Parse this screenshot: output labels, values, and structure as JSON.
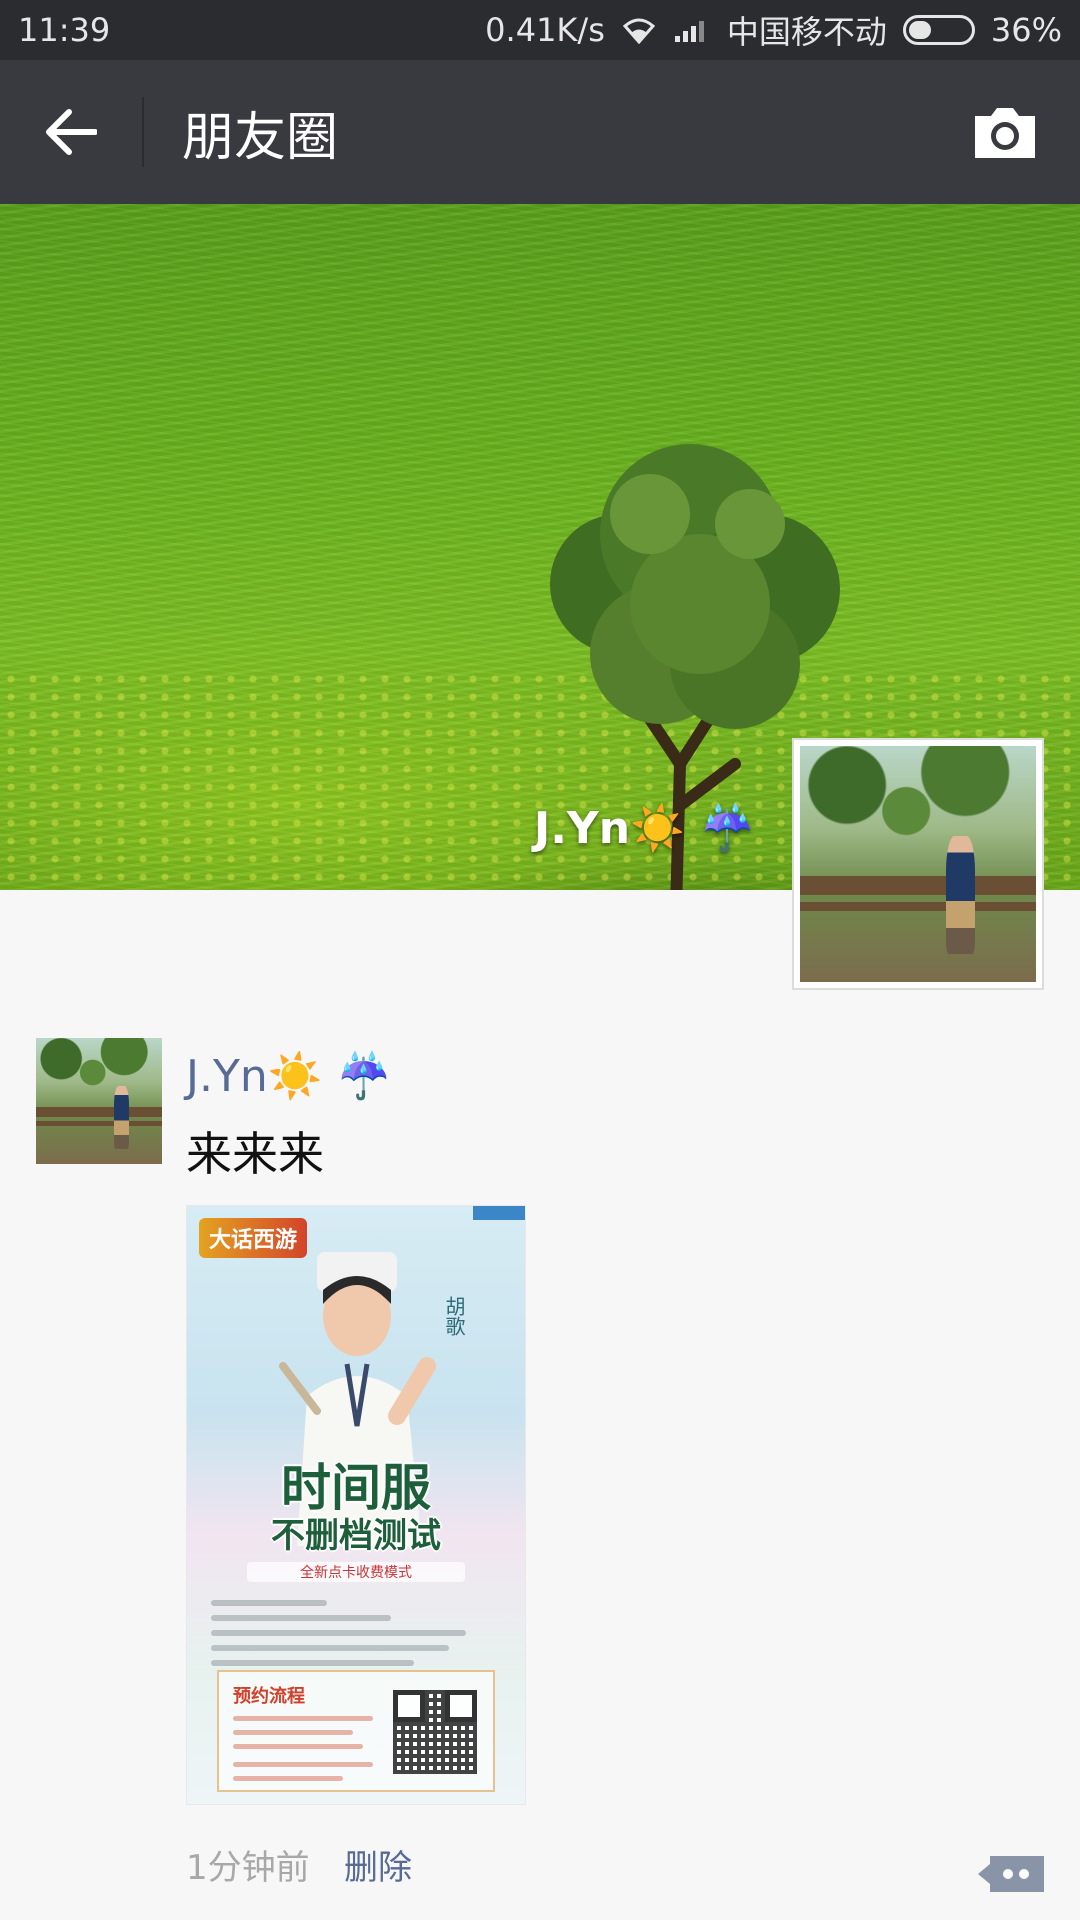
{
  "status_bar": {
    "time": "11:39",
    "network_speed": "0.41K/s",
    "carrier": "中国移不动",
    "battery_percent": "36%",
    "battery_level": 0.36,
    "wifi_icon": "wifi-icon",
    "signal_icon": "signal-icon"
  },
  "header": {
    "title": "朋友圈",
    "back_icon": "back-arrow-icon",
    "camera_icon": "camera-icon"
  },
  "cover": {
    "user_name": "J.Yn☀️ ☔️"
  },
  "post": {
    "user_name": "J.Yn☀️ ☔️",
    "text": "来来来",
    "image": {
      "logo": "大话西游",
      "side_name": "胡歌",
      "headline": "时间服",
      "headline2": "不删档测试",
      "tagline": "全新点卡收费模式",
      "box_title": "预约流程"
    },
    "time": "1分钟前",
    "delete_label": "删除",
    "comment_icon": "comment-more-icon"
  },
  "colors": {
    "status_bar_bg": "#2a2c30",
    "title_bar_bg": "#393a3f",
    "link_blue": "#576b95",
    "page_bg": "#f7f7f7"
  }
}
